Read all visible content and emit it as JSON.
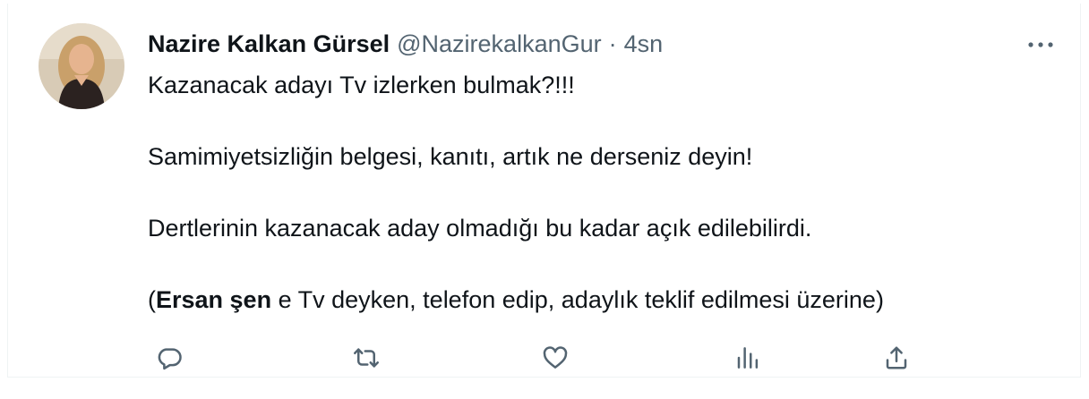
{
  "tweet": {
    "author": {
      "name": "Nazire Kalkan Gürsel",
      "handle": "@NazirekalkanGur",
      "separator": "·",
      "time": "4sn"
    },
    "paragraphs": [
      "Kazanacak adayı Tv izlerken bulmak?!!!",
      "Samimiyetsizliğin belgesi, kanıtı, artık ne derseniz deyin!",
      "Dertlerinin kazanacak aday olmadığı bu kadar açık edilebilirdi."
    ],
    "last_paragraph": {
      "open": "(",
      "bold": "Ersan şen",
      "rest": " e Tv deyken, telefon edip, adaylık teklif edilmesi üzerine)"
    },
    "icons": {
      "more": "more-horizontal-icon",
      "reply": "reply-icon",
      "retweet": "retweet-icon",
      "like": "heart-icon",
      "views": "views-icon",
      "share": "share-icon"
    },
    "colors": {
      "text": "#0f1419",
      "secondary": "#536471",
      "border": "#eff3f4"
    }
  }
}
